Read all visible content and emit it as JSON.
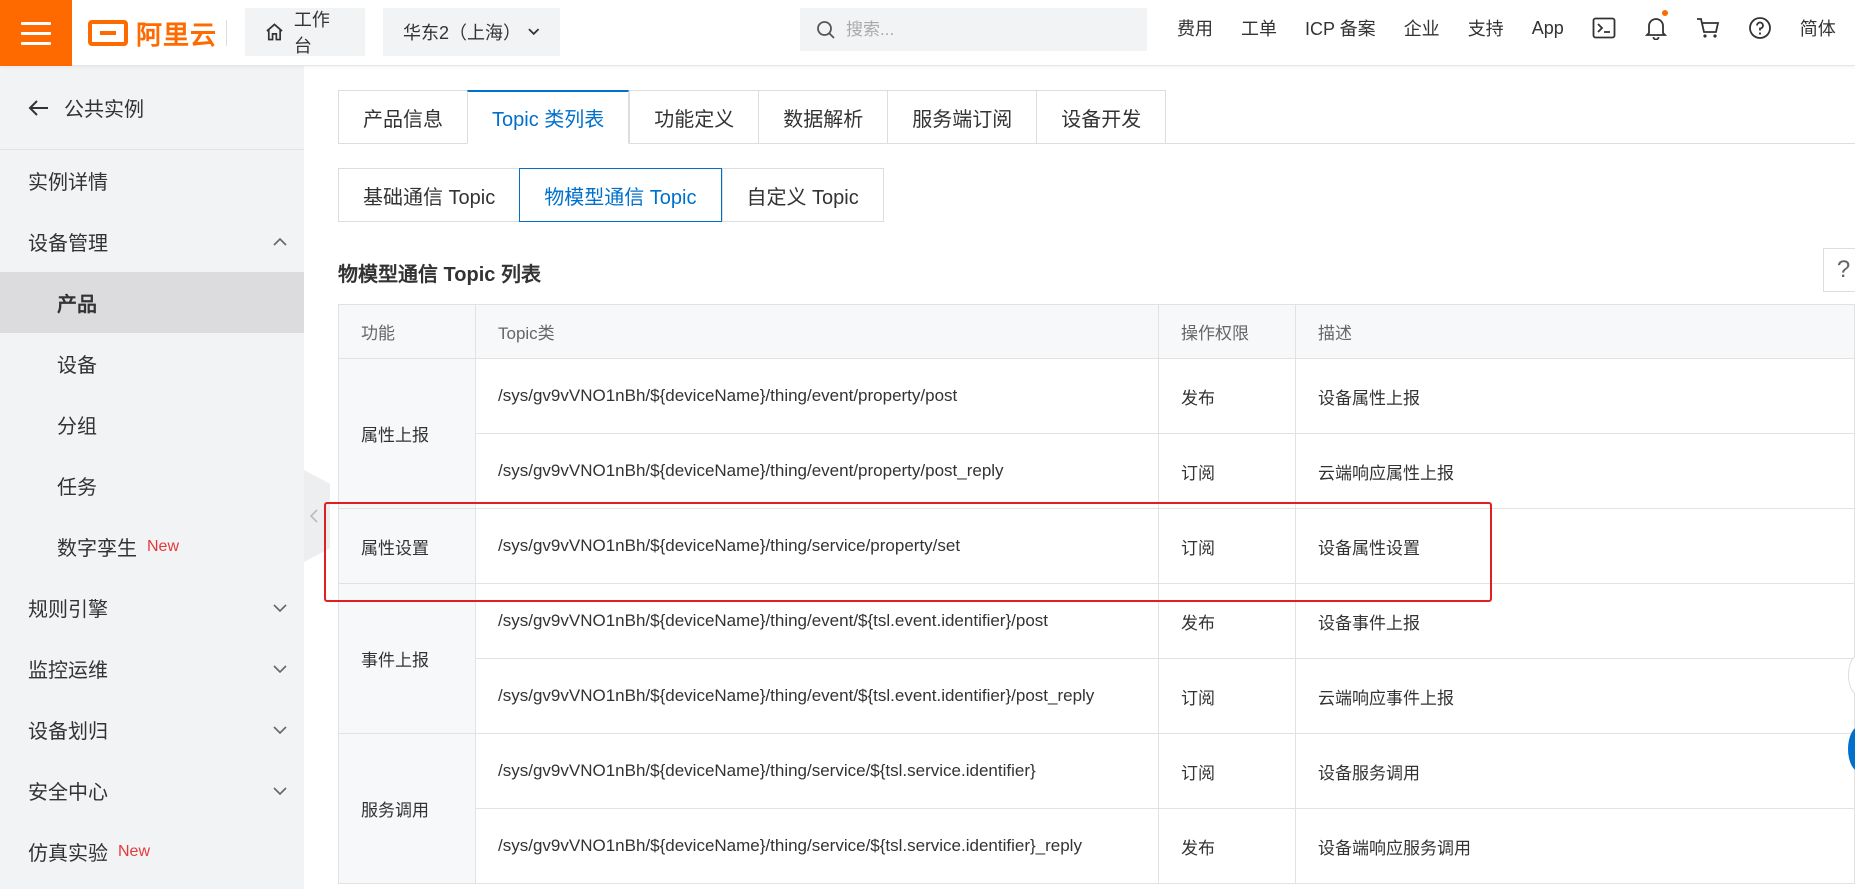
{
  "topbar": {
    "logo": "阿里云",
    "workbench": "工作台",
    "region": "华东2（上海）",
    "search_placeholder": "搜索...",
    "links": [
      "费用",
      "工单",
      "ICP 备案",
      "企业",
      "支持",
      "App"
    ],
    "lang": "简体",
    "icons": [
      "terminal-icon",
      "bell-icon",
      "cart-icon",
      "help-circle-icon"
    ],
    "accent": "#ff6a00"
  },
  "sidebar": {
    "back_label": "公共实例",
    "items": [
      {
        "label": "实例详情",
        "sub": false
      },
      {
        "label": "设备管理",
        "sub": false,
        "chevron": "up"
      },
      {
        "label": "产品",
        "sub": true,
        "active": true
      },
      {
        "label": "设备",
        "sub": true
      },
      {
        "label": "分组",
        "sub": true
      },
      {
        "label": "任务",
        "sub": true
      },
      {
        "label": "数字孪生",
        "sub": true,
        "badge": "New"
      },
      {
        "label": "规则引擎",
        "sub": false,
        "chevron": "down"
      },
      {
        "label": "监控运维",
        "sub": false,
        "chevron": "down"
      },
      {
        "label": "设备划归",
        "sub": false,
        "chevron": "down"
      },
      {
        "label": "安全中心",
        "sub": false,
        "chevron": "down"
      },
      {
        "label": "仿真实验",
        "sub": false,
        "badge": "New"
      }
    ]
  },
  "tabs": [
    "产品信息",
    "Topic 类列表",
    "功能定义",
    "数据解析",
    "服务端订阅",
    "设备开发"
  ],
  "active_tab": 1,
  "subtabs": [
    "基础通信 Topic",
    "物模型通信 Topic",
    "自定义 Topic"
  ],
  "active_subtab": 1,
  "section_title": "物模型通信 Topic 列表",
  "help": "?",
  "table": {
    "headers": [
      "功能",
      "Topic类",
      "操作权限",
      "描述"
    ],
    "groups": [
      {
        "func": "属性上报",
        "rows": [
          {
            "topic": "/sys/gv9vVNO1nBh/${deviceName}/thing/event/property/post",
            "perm": "发布",
            "desc": "设备属性上报"
          },
          {
            "topic": "/sys/gv9vVNO1nBh/${deviceName}/thing/event/property/post_reply",
            "perm": "订阅",
            "desc": "云端响应属性上报"
          }
        ]
      },
      {
        "func": "属性设置",
        "rows": [
          {
            "topic": "/sys/gv9vVNO1nBh/${deviceName}/thing/service/property/set",
            "perm": "订阅",
            "desc": "设备属性设置"
          }
        ]
      },
      {
        "func": "事件上报",
        "rows": [
          {
            "topic": "/sys/gv9vVNO1nBh/${deviceName}/thing/event/${tsl.event.identifier}/post",
            "perm": "发布",
            "desc": "设备事件上报"
          },
          {
            "topic": "/sys/gv9vVNO1nBh/${deviceName}/thing/event/${tsl.event.identifier}/post_reply",
            "perm": "订阅",
            "desc": "云端响应事件上报"
          }
        ]
      },
      {
        "func": "服务调用",
        "rows": [
          {
            "topic": "/sys/gv9vVNO1nBh/${deviceName}/thing/service/${tsl.service.identifier}",
            "perm": "订阅",
            "desc": "设备服务调用"
          },
          {
            "topic": "/sys/gv9vVNO1nBh/${deviceName}/thing/service/${tsl.service.identifier}_reply",
            "perm": "发布",
            "desc": "设备端响应服务调用"
          }
        ]
      }
    ]
  }
}
